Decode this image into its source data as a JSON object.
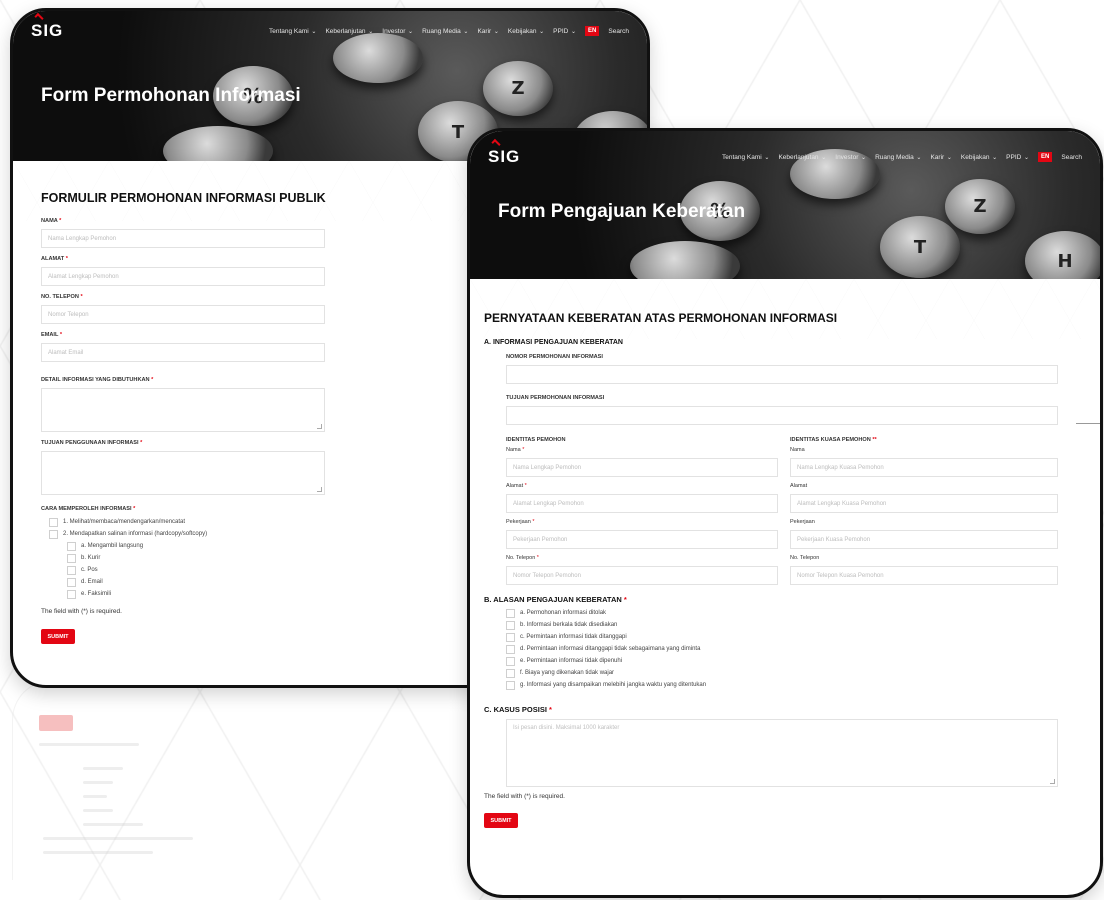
{
  "nav": {
    "logo": "SIG",
    "items": [
      "Tentang Kami",
      "Keberlanjutan",
      "Investor",
      "Ruang Media",
      "Karir",
      "Kebijakan",
      "PPID"
    ],
    "lang": "EN",
    "search": "Search"
  },
  "hero_keys": [
    "%",
    "Z",
    "T",
    "H"
  ],
  "form1": {
    "hero_title": "Form Permohonan Informasi",
    "heading": "FORMULIR PERMOHONAN INFORMASI PUBLIK",
    "fields": [
      {
        "label": "NAMA",
        "placeholder": "Nama Lengkap Pemohon"
      },
      {
        "label": "ALAMAT",
        "placeholder": "Alamat Lengkap Pemohon"
      },
      {
        "label": "NO. TELEPON",
        "placeholder": "Nomor Telepon"
      },
      {
        "label": "EMAIL",
        "placeholder": "Alamat Email"
      }
    ],
    "detail_label": "DETAIL INFORMASI YANG DIBUTUHKAN",
    "tujuan_label": "TUJUAN PENGGUNAAN INFORMASI",
    "cara_label": "CARA MEMPEROLEH INFORMASI",
    "cara_options": [
      "1. Melihat/membaca/mendengarkan/mencatat",
      "2. Mendapatkan salinan informasi (hardcopy/softcopy)"
    ],
    "sub_options": [
      "a. Mengambil langsung",
      "b. Kurir",
      "c. Pos",
      "d. Email",
      "e. Faksimili"
    ],
    "note": "The field with (*) is required.",
    "submit": "SUBMIT"
  },
  "form2": {
    "hero_title": "Form Pengajuan Keberatan",
    "heading": "PERNYATAAN KEBERATAN ATAS PERMOHONAN INFORMASI",
    "section_a": "A. INFORMASI PENGAJUAN KEBERATAN",
    "nomor_label": "NOMOR PERMOHONAN INFORMASI",
    "tujuan_label": "TUJUAN PERMOHONAN INFORMASI",
    "identitas_pemohon": "IDENTITAS PEMOHON",
    "identitas_kuasa": "IDENTITAS KUASA PEMOHON",
    "pemohon_fields": [
      {
        "label": "Nama",
        "placeholder": "Nama Lengkap Pemohon",
        "required": true
      },
      {
        "label": "Alamat",
        "placeholder": "Alamat Lengkap Pemohon",
        "required": true
      },
      {
        "label": "Pekerjaan",
        "placeholder": "Pekerjaan Pemohon",
        "required": true
      },
      {
        "label": "No. Telepon",
        "placeholder": "Nomor Telepon Pemohon",
        "required": true
      }
    ],
    "kuasa_fields": [
      {
        "label": "Nama",
        "placeholder": "Nama Lengkap Kuasa Pemohon"
      },
      {
        "label": "Alamat",
        "placeholder": "Alamat Lengkap Kuasa Pemohon"
      },
      {
        "label": "Pekerjaan",
        "placeholder": "Pekerjaan Kuasa Pemohon"
      },
      {
        "label": "No. Telepon",
        "placeholder": "Nomor Telepon Kuasa Pemohon"
      }
    ],
    "section_b": "B. ALASAN PENGAJUAN KEBERATAN",
    "alasan_options": [
      "a. Permohonan informasi ditolak",
      "b. Informasi berkala tidak disediakan",
      "c. Permintaan informasi tidak ditanggapi",
      "d. Permintaan informasi ditanggapi tidak sebagaimana yang diminta",
      "e. Permintaan informasi tidak dipenuhi",
      "f. Biaya yang dikenakan tidak wajar",
      "g. Informasi yang disampaikan melebihi jangka waktu yang ditentukan"
    ],
    "section_c": "C. KASUS POSISI",
    "kasus_placeholder": "Isi pesan disini. Maksimal 1000 karakter",
    "note": "The field with (*) is required.",
    "submit": "SUBMIT"
  }
}
